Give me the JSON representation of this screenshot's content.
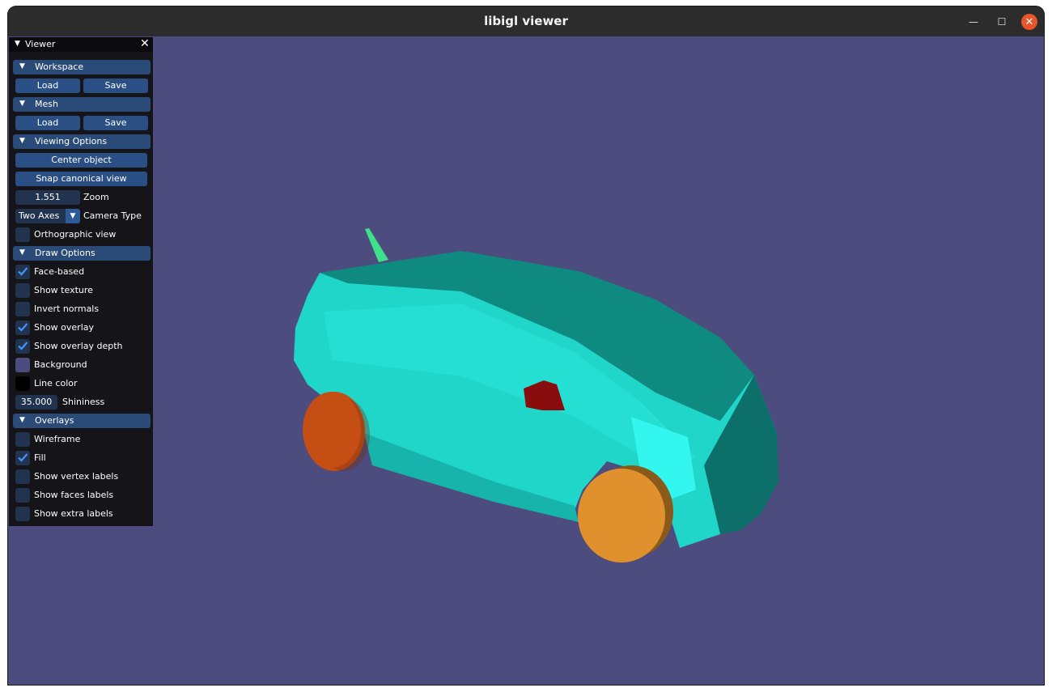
{
  "window": {
    "title": "libigl viewer",
    "controls": {
      "minimize": "—",
      "maximize": "☐",
      "close": "✕"
    }
  },
  "panel": {
    "title": "Viewer",
    "close_glyph": "✕",
    "sections": {
      "workspace": {
        "label": "Workspace",
        "load": "Load",
        "save": "Save"
      },
      "mesh": {
        "label": "Mesh",
        "load": "Load",
        "save": "Save"
      },
      "viewing": {
        "label": "Viewing Options",
        "center": "Center object",
        "snap": "Snap canonical view",
        "zoom_value": "1.551",
        "zoom_label": "Zoom",
        "camera_value": "Two Axes",
        "camera_label": "Camera Type",
        "ortho_label": "Orthographic view",
        "ortho_checked": false
      },
      "draw": {
        "label": "Draw Options",
        "face_based": "Face-based",
        "face_based_checked": true,
        "show_texture": "Show texture",
        "show_texture_checked": false,
        "invert_normals": "Invert normals",
        "invert_normals_checked": false,
        "show_overlay": "Show overlay",
        "show_overlay_checked": true,
        "show_overlay_depth": "Show overlay depth",
        "show_overlay_depth_checked": true,
        "background": "Background",
        "background_color": "#4c4c7e",
        "line_color": "Line color",
        "line_color_value": "#000000",
        "shininess_value": "35.000",
        "shininess_label": "Shininess"
      },
      "overlays": {
        "label": "Overlays",
        "wireframe": "Wireframe",
        "wireframe_checked": false,
        "fill": "Fill",
        "fill_checked": true,
        "vertex_labels": "Show vertex labels",
        "vertex_labels_checked": false,
        "faces_labels": "Show faces labels",
        "faces_labels_checked": false,
        "extra_labels": "Show extra labels",
        "extra_labels_checked": false
      }
    }
  },
  "scene": {
    "background": "#4c4c7e",
    "car_body_color": "#1fd6c8",
    "wheel_rear_color": "#c54e14",
    "wheel_front_color": "#e0902c",
    "mirror_color": "#8a0d0d",
    "antenna_color": "#3fe08a"
  }
}
